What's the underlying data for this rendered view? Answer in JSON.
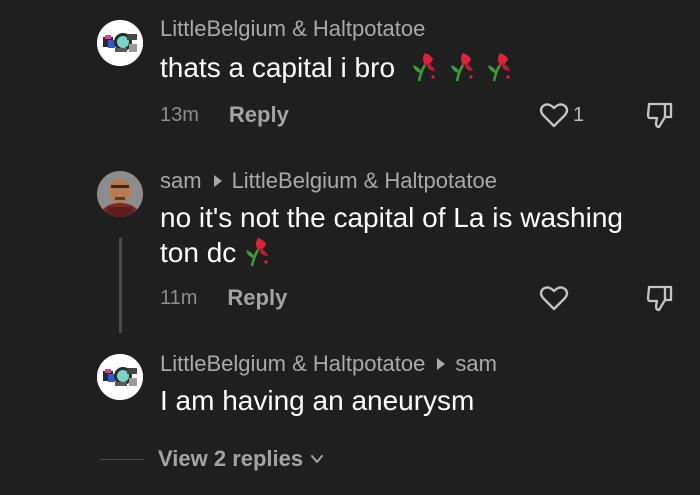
{
  "comments": [
    {
      "author": "LittleBelgium & Haltpotatoe",
      "reply_to": "",
      "text": "thats a capital i bro",
      "emoji": "rose-icon x3",
      "time": "13m",
      "reply_label": "Reply",
      "likes": "1"
    },
    {
      "author": "sam",
      "reply_to": "LittleBelgium & Haltpotatoe",
      "text_line1": "no it's not the capital of La is washing",
      "text_line2": "ton dc",
      "emoji": "rose-icon x1",
      "time": "11m",
      "reply_label": "Reply",
      "likes": ""
    },
    {
      "author": "LittleBelgium & Haltpotatoe",
      "reply_to": "sam",
      "text": "I am having an aneurysm"
    }
  ],
  "view_replies": "View 2 replies",
  "colors": {
    "background": "#1f1f1f",
    "username": "#a9a9a9",
    "body": "#ffffff",
    "meta": "#8d8d8d",
    "rose_red": "#d9243a",
    "rose_stem": "#3f9b3a"
  }
}
